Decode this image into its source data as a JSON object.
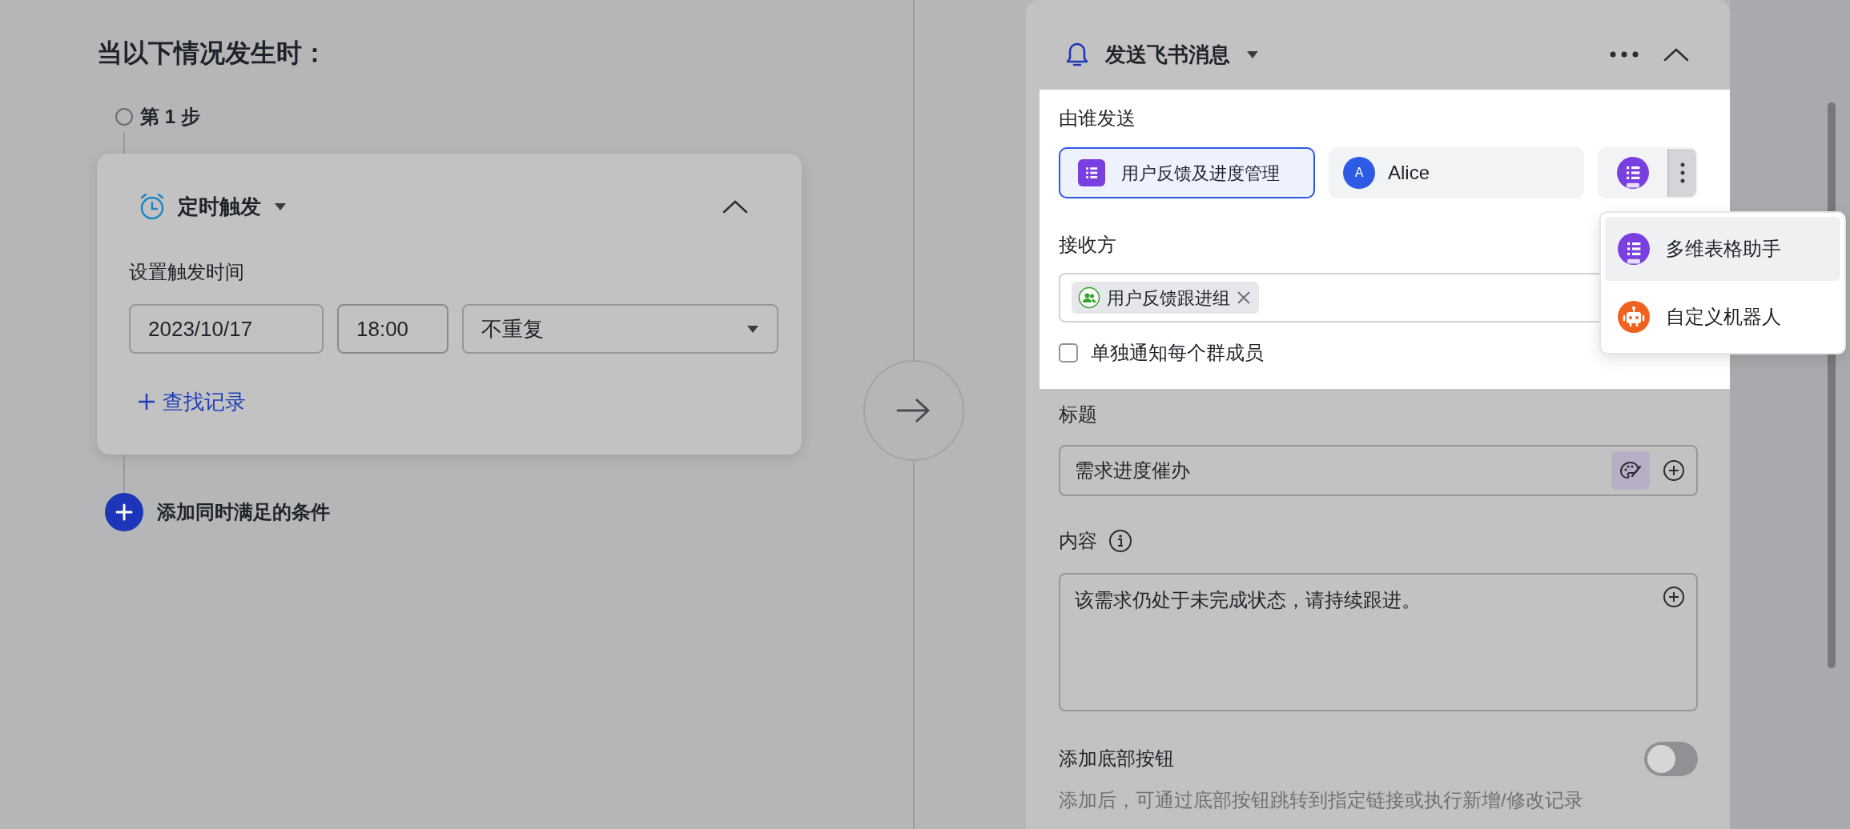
{
  "trigger_panel": {
    "heading": "当以下情况发生时：",
    "step": "第 1 步",
    "card": {
      "trigger": "定时触发",
      "expanded": true,
      "field_label": "设置触发时间",
      "date": "2023/10/17",
      "time": "18:00",
      "repeat": "不重复",
      "find_records": "查找记录"
    },
    "add_condition": "添加同时满足的条件"
  },
  "action_panel": {
    "title": "发送飞书消息",
    "expanded": true,
    "sender": {
      "label": "由谁发送",
      "options": [
        {
          "kind": "base",
          "label": "用户反馈及进度管理",
          "selected": true
        },
        {
          "kind": "user",
          "avatar": "A",
          "label": "Alice",
          "selected": false
        },
        {
          "kind": "bot",
          "selected": false
        }
      ]
    },
    "bot_menu": [
      {
        "kind": "base-bot",
        "label": "多维表格助手",
        "selected": true
      },
      {
        "kind": "custom-bot",
        "label": "自定义机器人",
        "selected": false
      }
    ],
    "recipients": {
      "label": "接收方",
      "tags": [
        {
          "label": "用户反馈跟进组"
        }
      ]
    },
    "notify_each": {
      "label": "单独通知每个群成员",
      "checked": false
    },
    "title_field": {
      "label": "标题",
      "value": "需求进度催办"
    },
    "content_field": {
      "label": "内容",
      "value": "该需求仍处于未完成状态，请持续跟进。"
    },
    "bottom_button": {
      "label": "添加底部按钮",
      "on": false,
      "hint": "添加后，可通过底部按钮跳转到指定链接或执行新增/修改记录"
    }
  }
}
